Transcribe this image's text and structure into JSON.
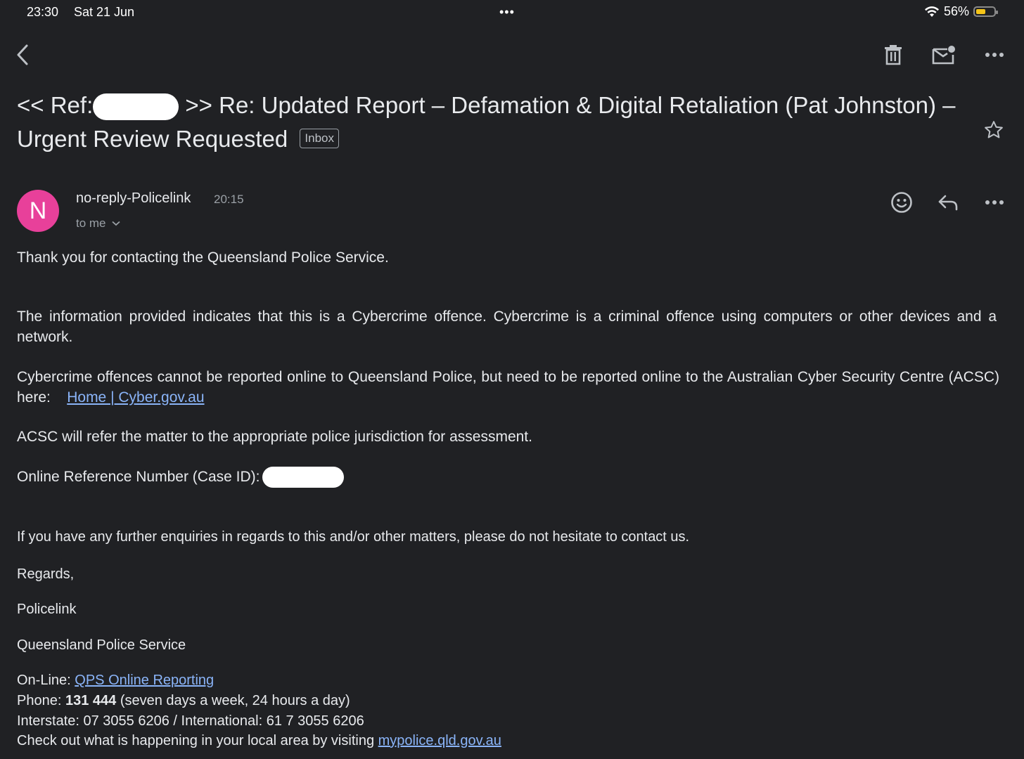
{
  "status": {
    "time": "23:30",
    "date": "Sat 21 Jun",
    "dots": "•••",
    "battery": "56%",
    "battery_level": 0.56
  },
  "toolbar": {
    "back_icon": "chevron-left-icon",
    "delete_icon": "trash-icon",
    "mark_unread_icon": "mail-unread-icon",
    "more_icon": "more-horizontal-icon"
  },
  "subject": {
    "prefix": "<< Ref:",
    "suffix": ">> Re: Updated Report – Defamation & Digital Retaliation (Pat Johnston) – Urgent Review Requested",
    "label": "Inbox"
  },
  "message": {
    "avatar_letter": "N",
    "avatar_color": "#e8409a",
    "sender": "no-reply-Policelink",
    "time": "20:15",
    "recipient": "to me"
  },
  "body": {
    "p1": "Thank you for contacting the Queensland Police Service.",
    "p2": "The information provided indicates that this is a Cybercrime offence.  Cybercrime is a criminal offence using computers or other devices and a network.",
    "p3_text": "Cybercrime offences cannot be reported online to Queensland Police, but need to be reported online to the Australian Cyber Security Centre (ACSC) here:",
    "p3_link": "Home | Cyber.gov.au",
    "p4": "ACSC will refer the matter to the appropriate police jurisdiction for assessment.",
    "p5": "Online Reference Number (Case ID):",
    "p6": "If you have any further enquiries in regards to this and/or other matters, please do not hesitate to contact us.",
    "regards": "Regards,",
    "sig_name": "Policelink",
    "sig_org": "Queensland Police Service",
    "online_label": "On-Line:",
    "online_link": "QPS Online Reporting",
    "phone_label": "Phone:",
    "phone_number": "131 444",
    "phone_note": "(seven days a week, 24 hours a day)",
    "interstate": "Interstate: 07 3055 6206 / International: 61 7 3055 6206",
    "local_text": "Check out what is happening in your local area by visiting",
    "local_link": "mypolice.qld.gov.au"
  },
  "colors": {
    "background": "#202124",
    "link": "#8ab4f8",
    "text": "#e8eaed",
    "muted": "#9aa0a6"
  }
}
